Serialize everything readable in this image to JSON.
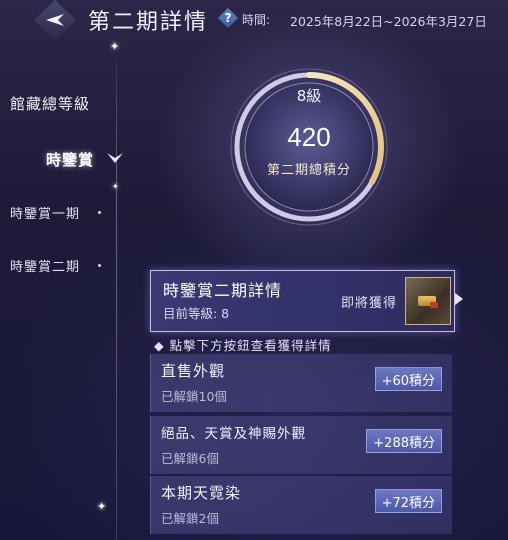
{
  "header": {
    "title": "第二期詳情",
    "help_icon": "question-diamond-icon",
    "period_label": "時間:",
    "period_value": "2025年8月22日~2026年3月27日"
  },
  "nav": {
    "main_label": "館藏總等級",
    "current_label": "時鑒賞",
    "items": [
      {
        "label": "時鑒賞一期"
      },
      {
        "label": "時鑒賞二期"
      }
    ]
  },
  "ring": {
    "level": "8級",
    "score": "420",
    "score_label": "第二期總積分",
    "progress_fraction": 0.33
  },
  "detail": {
    "title": "時鑒賞二期詳情",
    "level_text": "目前等級:  8",
    "reward_label": "即將獲得"
  },
  "hint": "◆ 點擊下方按鈕查看獲得詳情",
  "categories": [
    {
      "title": "直售外觀",
      "sub": "已解鎖10個",
      "points": "+60積分"
    },
    {
      "title": "絕品、天賞及神賜外觀",
      "sub": "已解鎖6個",
      "points": "+288積分"
    },
    {
      "title": "本期天霓染",
      "sub": "已解鎖2個",
      "points": "+72積分"
    }
  ],
  "colors": {
    "background": "#1d1b38",
    "accent": "#5a66b2",
    "panel_border": "#dcd7ff"
  }
}
